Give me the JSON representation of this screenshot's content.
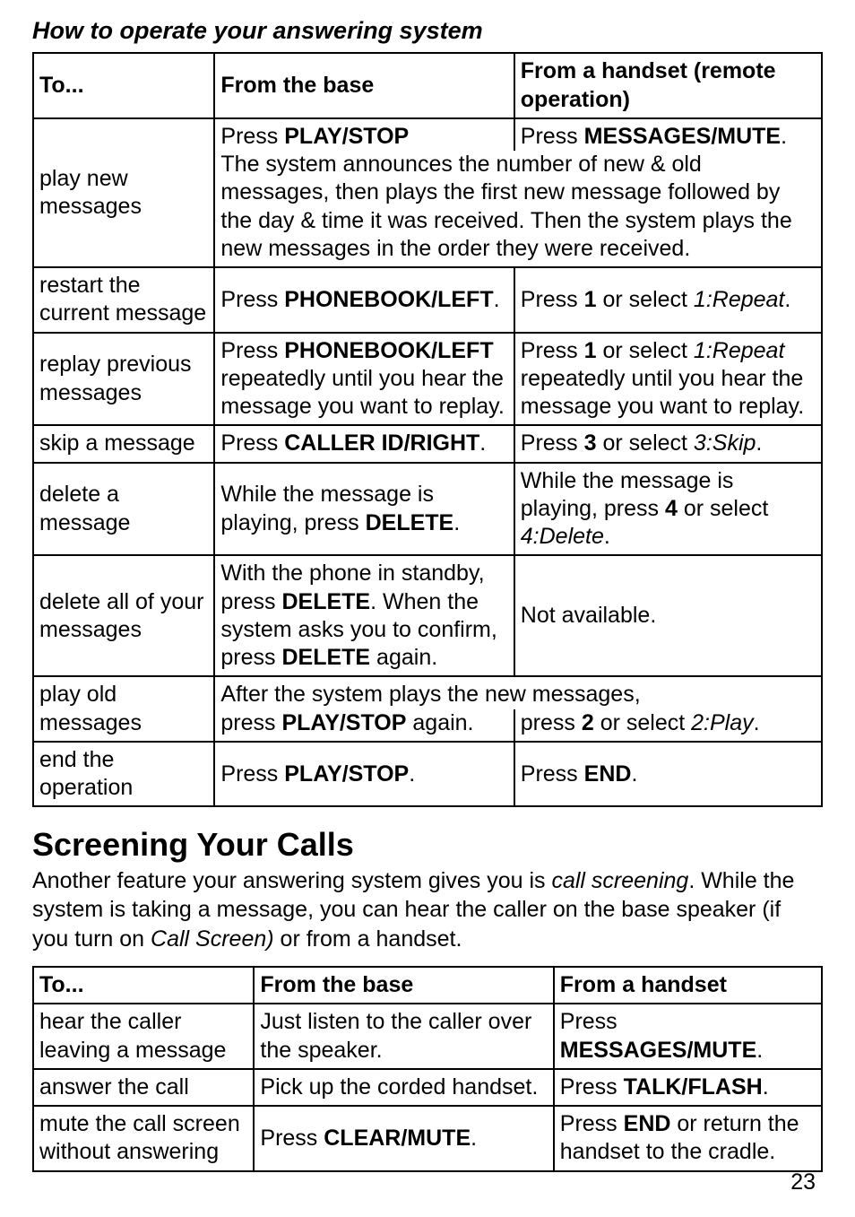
{
  "subhead": "How to operate your answering system",
  "table1": {
    "head": {
      "c1": "To...",
      "c2": "From the base",
      "c3": "From a handset (remote operation)"
    },
    "play_new": {
      "label": "play new messages",
      "base_press": "Press ",
      "base_btn": "PLAY/STOP",
      "hs_press": "Press ",
      "hs_btn": "MESSAGES/MUTE",
      "hs_period": ".",
      "body": "The system announces the number of new & old messages, then plays the first new message followed by the day & time it was received. Then the system plays the new messages in the order they were received."
    },
    "restart": {
      "label": "restart the current message",
      "base_press": "Press ",
      "base_btn": "PHONEBOOK/LEFT",
      "base_period": ".",
      "hs_a": "Press ",
      "hs_key": "1",
      "hs_b": " or select ",
      "hs_opt": "1:Repeat",
      "hs_c": "."
    },
    "replay": {
      "label": "replay previous messages",
      "base_a": "Press ",
      "base_btn": "PHONEBOOK/LEFT",
      "base_b": " repeatedly until you hear the message you want to replay.",
      "hs_a": "Press ",
      "hs_key": "1",
      "hs_b": " or select ",
      "hs_opt": "1:Repeat",
      "hs_c": " repeatedly until you hear the message you want to replay."
    },
    "skip": {
      "label": "skip a message",
      "base_a": "Press ",
      "base_btn": "CALLER ID/RIGHT",
      "base_b": ".",
      "hs_a": "Press ",
      "hs_key": "3",
      "hs_b": " or select ",
      "hs_opt": "3:Skip",
      "hs_c": "."
    },
    "delete": {
      "label": "delete a message",
      "base_a": "While the message is playing, press ",
      "base_btn": "DELETE",
      "base_b": ".",
      "hs_a": "While the message is playing, press ",
      "hs_key": "4",
      "hs_b": " or select ",
      "hs_opt": "4:Delete",
      "hs_c": "."
    },
    "delete_all": {
      "label": "delete all of your messages",
      "base_a": "With the phone in standby, press ",
      "base_btn1": "DELETE",
      "base_b": ". When the system asks you to confirm, press ",
      "base_btn2": "DELETE",
      "base_c": " again.",
      "hs": "Not available."
    },
    "play_old": {
      "label": "play old messages",
      "top": "After the system plays the new messages,",
      "base_a": "press ",
      "base_btn": "PLAY/STOP",
      "base_b": " again.",
      "hs_a": "press ",
      "hs_key": "2",
      "hs_b": " or select ",
      "hs_opt": "2:Play",
      "hs_c": "."
    },
    "end": {
      "label": "end the operation",
      "base_a": "Press ",
      "base_btn": "PLAY/STOP",
      "base_b": ".",
      "hs_a": "Press ",
      "hs_btn": "END",
      "hs_b": "."
    }
  },
  "section_title": "Screening Your Calls",
  "intro_a": "Another feature your answering system gives you is ",
  "intro_em1": "call screening",
  "intro_b": ". While the system is taking a message, you can hear the caller on the base speaker (if you turn on ",
  "intro_em2": "Call Screen)",
  "intro_c": " or from a handset.",
  "table2": {
    "head": {
      "c1": "To...",
      "c2": "From the base",
      "c3": "From a handset"
    },
    "hear": {
      "label": "hear the caller leaving a message",
      "base": "Just listen to the caller over the speaker.",
      "hs_a": "Press ",
      "hs_btn": "MESSAGES/MUTE",
      "hs_b": "."
    },
    "answer": {
      "label": "answer the call",
      "base": "Pick up the corded handset.",
      "hs_a": "Press ",
      "hs_btn": "TALK/FLASH",
      "hs_b": "."
    },
    "mute": {
      "label": "mute the call screen without answering",
      "base_a": "Press ",
      "base_btn": "CLEAR/MUTE",
      "base_b": ".",
      "hs_a": "Press ",
      "hs_btn": "END",
      "hs_b": " or return the handset to the cradle."
    }
  },
  "page_number": "23"
}
